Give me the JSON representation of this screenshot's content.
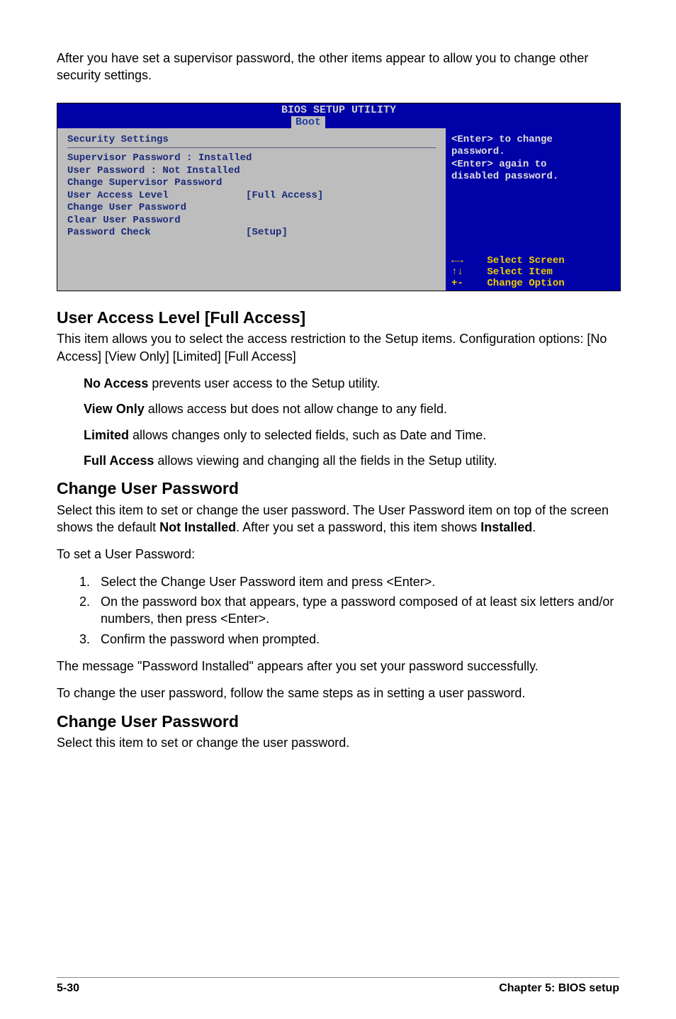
{
  "intro": "After you have set a supervisor password, the other items appear to allow you to change other security settings.",
  "bios": {
    "title": "BIOS SETUP UTILITY",
    "tab": "Boot",
    "section_heading": "Security Settings",
    "sup_label": "Supervisor Password  : Installed",
    "user_label": "User Password       : Not Installed",
    "items": {
      "change_sup": "Change Supervisor Password",
      "ual_label": "User Access Level",
      "ual_value": "[Full Access]",
      "change_user": "Change User Password",
      "clear_user": "Clear User Password",
      "pw_check_label": "Password Check",
      "pw_check_value": "[Setup]"
    },
    "help": "<Enter> to change\npassword.\n<Enter> again to\ndisabled password.",
    "legend": "←→    Select Screen\n↑↓    Select Item\n+-    Change Option"
  },
  "ual": {
    "heading": "User Access Level [Full Access]",
    "body": "This item allows you to select the access restriction to the Setup items. Configuration options: [No Access] [View Only] [Limited] [Full Access]",
    "noaccess": {
      "term": "No Access",
      "desc": " prevents user access to the Setup utility."
    },
    "viewonly": {
      "term": "View Only",
      "desc": " allows access but does not allow change to any field."
    },
    "limited": {
      "term": "Limited",
      "desc": " allows changes only to selected fields, such as Date and Time."
    },
    "full": {
      "term": "Full Access",
      "desc": " allows viewing and changing all the fields in the Setup utility."
    }
  },
  "cup1": {
    "heading": "Change User Password",
    "body_pre": "Select this item to set or change the user password. The User Password item on top of the screen shows the default ",
    "bold1": "Not Installed",
    "body_mid": ". After you set a password, this item shows ",
    "bold2": "Installed",
    "body_post": ".",
    "toset": "To set a User Password:",
    "steps": [
      "Select the Change User Password item and press <Enter>.",
      "On the password box that appears, type a password composed of at least six letters and/or numbers, then press <Enter>.",
      "Confirm the password when prompted."
    ],
    "after1": "The message \"Password Installed\" appears after you set your password successfully.",
    "after2": "To change the user password, follow the same steps as in setting a user password."
  },
  "cup2": {
    "heading": "Change User Password",
    "body": "Select this item to set or change the user password."
  },
  "footer": {
    "left": "5-30",
    "right": "Chapter 5: BIOS setup"
  }
}
